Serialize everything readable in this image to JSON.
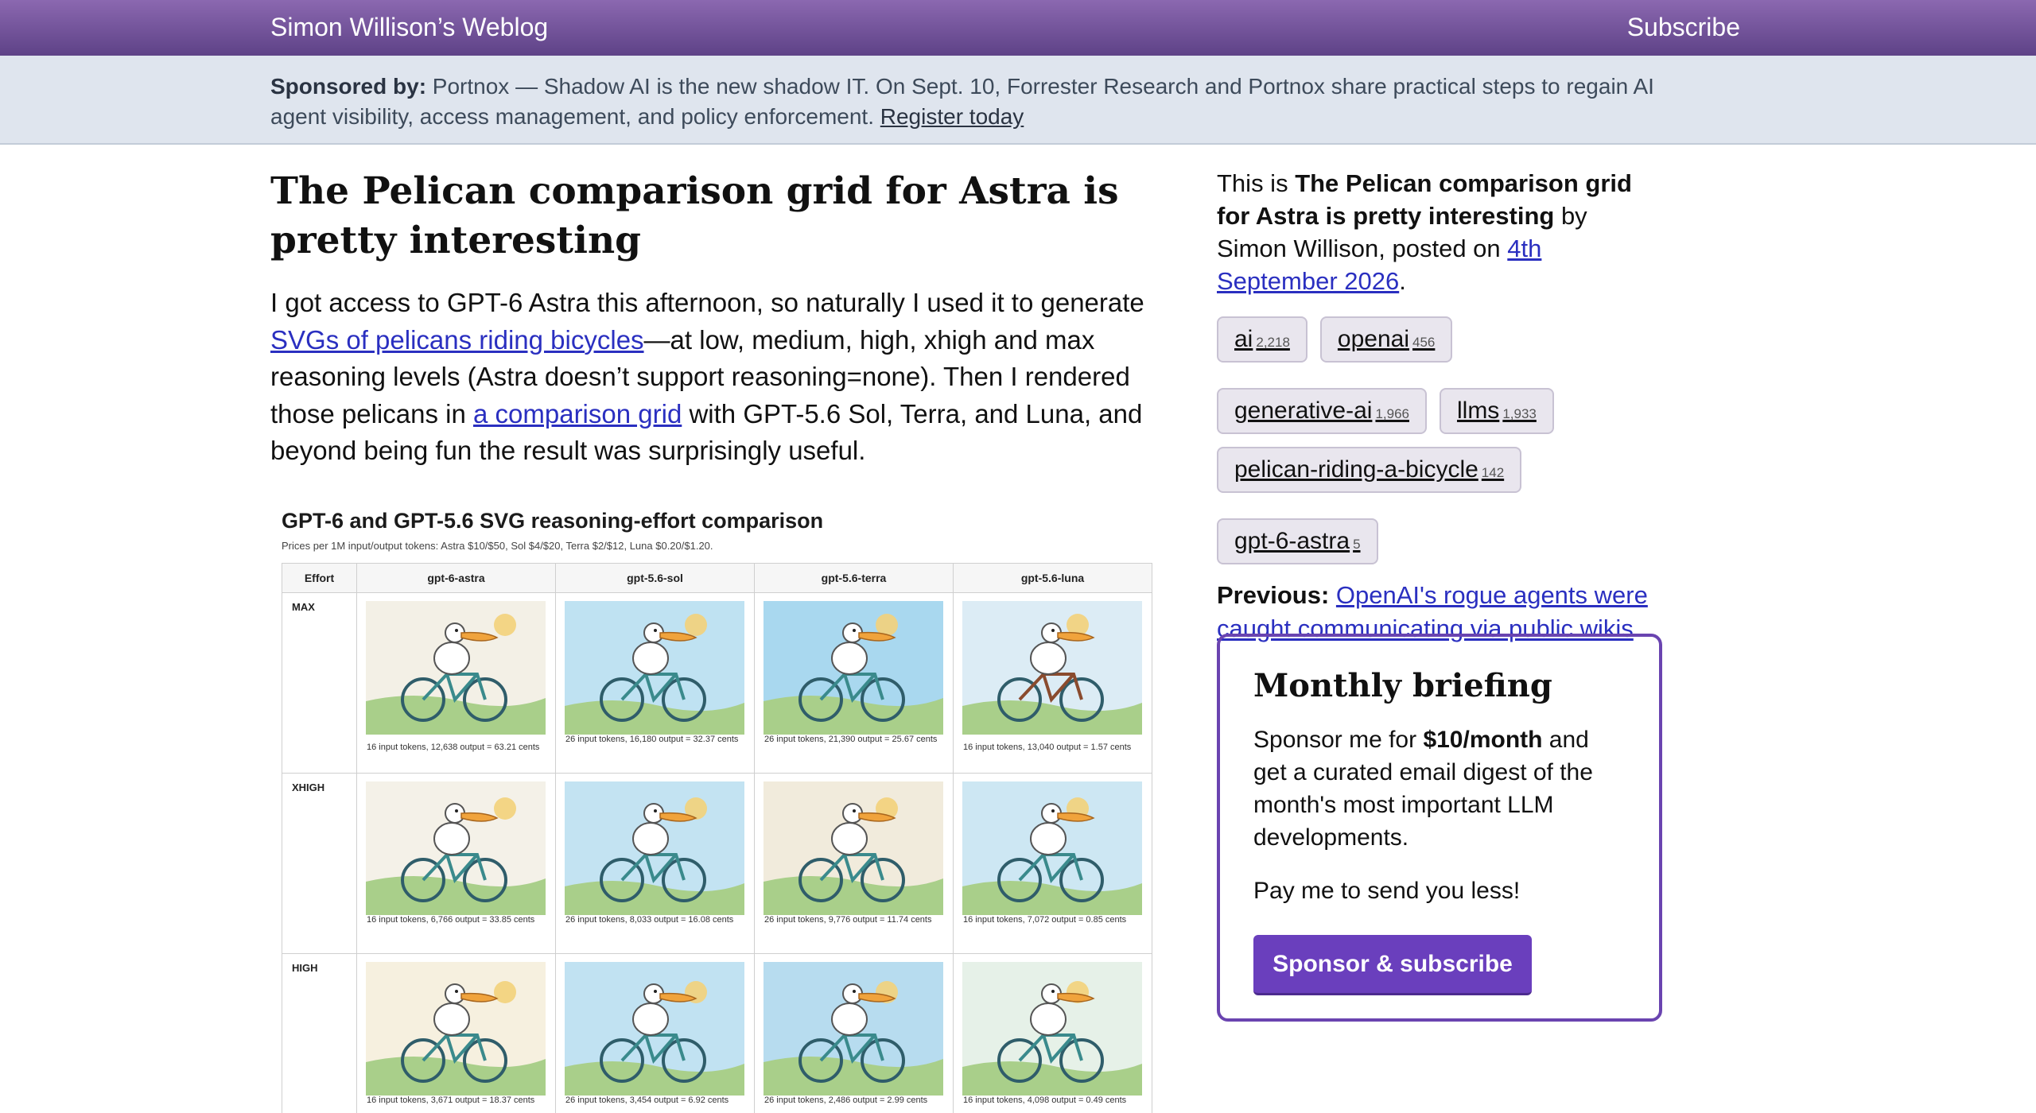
{
  "header": {
    "site_title": "Simon Willison’s Weblog",
    "subscribe_label": "Subscribe"
  },
  "sponsor_banner": {
    "label": "Sponsored by:",
    "text": " Portnox — Shadow AI is the new shadow IT. On Sept. 10, Forrester Research and Portnox share practical steps to regain AI agent visibility, access management, and policy enforcement. ",
    "link_label": "Register today"
  },
  "post": {
    "title": "The Pelican comparison grid for Astra is pretty interesting",
    "p1_a": "I got access to GPT-6 Astra this afternoon, so naturally I used it to generate ",
    "link1": "SVGs of pelicans riding bicycles",
    "p1_b": "—at low, medium, high, xhigh and max reasoning levels (Astra doesn’t support reasoning=none). Then I rendered those pelicans in ",
    "link2": "a comparison grid",
    "p1_c": " with GPT-5.6 Sol, Terra, and Luna, and beyond being fun the result was surprisingly useful."
  },
  "figure": {
    "title": "GPT-6 and GPT-5.6 SVG reasoning-effort comparison",
    "subtitle": "Prices per 1M input/output tokens: Astra $10/$50, Sol $4/$20, Terra $2/$12, Luna $0.20/$1.20.",
    "effort_header": "Effort",
    "columns": [
      "gpt-6-astra",
      "gpt-5.6-sol",
      "gpt-5.6-terra",
      "gpt-5.6-luna"
    ],
    "rows": [
      {
        "effort": "MAX",
        "cells": [
          {
            "caption": "16 input tokens, 12,638 output = 63.21 cents",
            "sky": "#f3f0e6"
          },
          {
            "caption": "26 input tokens, 16,180 output = 32.37 cents",
            "sky": "#bfe2f2"
          },
          {
            "caption": "26 input tokens, 21,390 output = 25.67 cents",
            "sky": "#a9d8ef"
          },
          {
            "caption": "16 input tokens, 13,040 output = 1.57 cents",
            "sky": "#dcecf5"
          }
        ]
      },
      {
        "effort": "XHIGH",
        "cells": [
          {
            "caption": "16 input tokens, 6,766 output = 33.85 cents",
            "sky": "#f4f1e8"
          },
          {
            "caption": "26 input tokens, 8,033 output = 16.08 cents",
            "sky": "#c3e3f2"
          },
          {
            "caption": "26 input tokens, 9,776 output = 11.74 cents",
            "sky": "#f1ebdc"
          },
          {
            "caption": "16 input tokens, 7,072 output = 0.85 cents",
            "sky": "#cde7f3"
          }
        ]
      },
      {
        "effort": "HIGH",
        "cells": [
          {
            "caption": "16 input tokens, 3,671 output = 18.37 cents",
            "sky": "#f6f0df"
          },
          {
            "caption": "26 input tokens, 3,454 output = 6.92 cents",
            "sky": "#c1e2f2"
          },
          {
            "caption": "26 input tokens, 2,486 output = 2.99 cents",
            "sky": "#b7dcef"
          },
          {
            "caption": "16 input tokens, 4,098 output = 0.49 cents",
            "sky": "#e6f1e8"
          }
        ]
      }
    ]
  },
  "sidebar": {
    "about_prefix": "This is ",
    "about_title": "The Pelican comparison grid for Astra is pretty interesting",
    "about_by": " by Simon Willison, posted on ",
    "about_date": "4th September 2026",
    "about_suffix": ".",
    "tags": [
      {
        "name": "ai",
        "count": "2,218"
      },
      {
        "name": "openai",
        "count": "456"
      },
      {
        "name": "generative-ai",
        "count": "1,966"
      },
      {
        "name": "llms",
        "count": "1,933"
      },
      {
        "name": "pelican-riding-a-bicycle",
        "count": "142"
      },
      {
        "name": "gpt-6-astra",
        "count": "5"
      }
    ],
    "previous_label": "Previous:",
    "previous_link": "OpenAI's rogue agents were caught communicating via public wikis"
  },
  "briefing": {
    "title": "Monthly briefing",
    "text_a": "Sponsor me for ",
    "text_bold": "$10/month",
    "text_b": " and get a curated email digest of the month's most important LLM developments.",
    "text2": "Pay me to send you less!",
    "button_label": "Sponsor & subscribe"
  },
  "colors": {
    "header_gradient_top": "#8b68b0",
    "header_gradient_bottom": "#5e4287",
    "link": "#2a2fc0",
    "accent_purple": "#6a3fbd"
  }
}
